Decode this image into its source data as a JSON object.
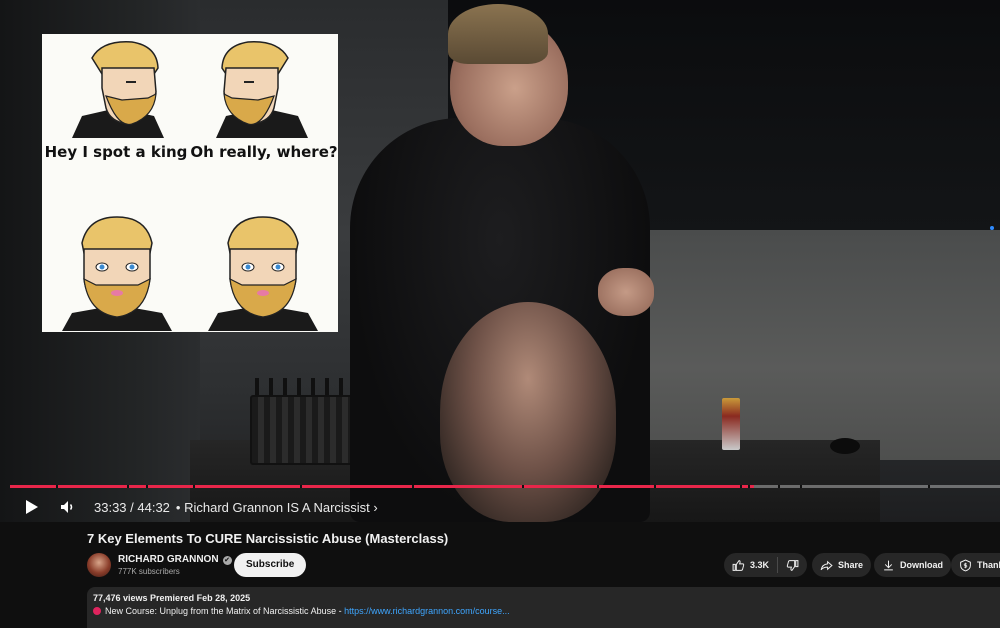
{
  "meme": {
    "top_left_caption": "Hey I spot a king",
    "top_right_caption": "Oh really, where?"
  },
  "player": {
    "time_display": "33:33 / 44:32",
    "separator": "•",
    "chapter_title": "Richard Grannon IS A Narcissist",
    "chapter_chevron": "›",
    "progress_fraction": 0.752,
    "progress_color": "#e8264a"
  },
  "video": {
    "title": "7 Key Elements To CURE Narcissistic Abuse (Masterclass)"
  },
  "channel": {
    "name": "RICHARD GRANNON",
    "verified_glyph": "✔",
    "subscribers": "777K subscribers",
    "subscribe_label": "Subscribe"
  },
  "actions": {
    "likes": "3.3K",
    "share_label": "Share",
    "download_label": "Download",
    "thanks_label": "Thanks"
  },
  "description": {
    "stats": "77,476 views  Premiered Feb 28, 2025",
    "course_text": "New Course: Unplug from the Matrix of Narcissistic Abuse  -",
    "course_link": "https://www.richardgrannon.com/course..."
  },
  "icons": {
    "play": "play-icon",
    "volume": "volume-icon",
    "like": "thumbs-up-icon",
    "dislike": "thumbs-down-icon",
    "share": "share-arrow-icon",
    "download": "download-icon",
    "thanks": "thanks-dollar-icon"
  }
}
